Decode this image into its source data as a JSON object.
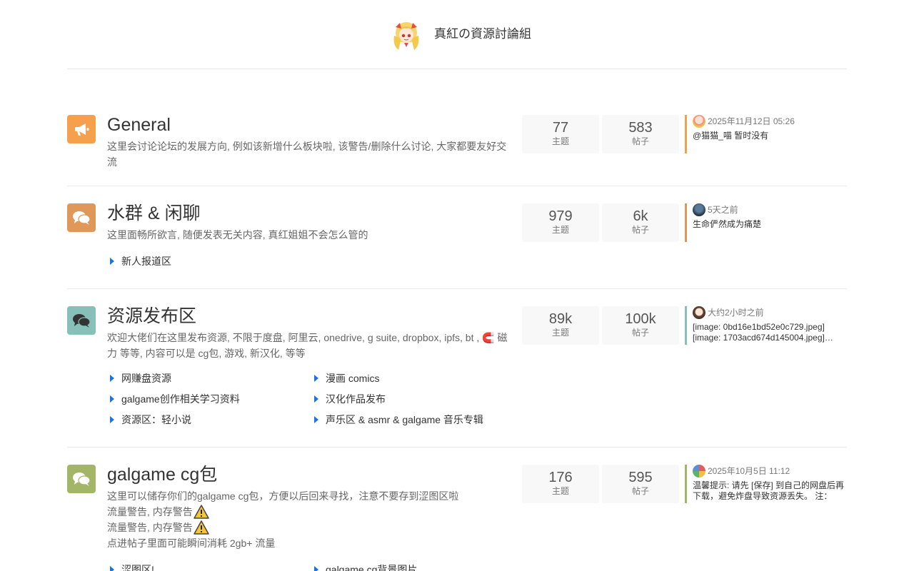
{
  "site": {
    "title": "真紅の資源討論組"
  },
  "categories": [
    {
      "name": "General",
      "icon": "megaphone-icon",
      "color": "#f5a04d",
      "desc": [
        "这里会讨论论坛的发展方向, 例如该新增什么板块啦, 该警告/删除什么讨论, 大家都要友好交流"
      ],
      "topics": "77",
      "posts": "583",
      "topics_label": "主题",
      "posts_label": "帖子",
      "latest_time": "2025年11月12日 05:26",
      "latest_text": "@猫猫_喵 暂时没有",
      "latest_color": "#f5a04d",
      "subcats": []
    },
    {
      "name": "水群 & 闲聊",
      "icon": "chat-bubbles-icon",
      "color": "#e0975a",
      "desc": [
        "这里面畅所欲言, 随便发表无关内容, 真红姐姐不会怎么管的"
      ],
      "topics": "979",
      "posts": "6k",
      "topics_label": "主题",
      "posts_label": "帖子",
      "latest_time": "5天之前",
      "latest_text": "生命俨然成为痛楚",
      "latest_color": "#e0975a",
      "subcats": [
        "新人报道区"
      ]
    },
    {
      "name": "资源发布区",
      "icon": "chat-bubbles-icon",
      "color": "#86c0b8",
      "desc": [
        "欢迎大佬们在这里发布资源, 不限于度盘, 阿里云, onedrive, g suite, dropbox, ipfs, bt , 🧲 磁力 等等, 内容可以是 cg包, 游戏, 新汉化, 等等"
      ],
      "topics": "89k",
      "posts": "100k",
      "topics_label": "主题",
      "posts_label": "帖子",
      "latest_time": "大约2小时之前",
      "latest_text": "[image: 0bd16e1bd52e0c729.jpeg] [image: 1703acd674d145004.jpeg]…",
      "latest_color": "#86c0b8",
      "subcats": [
        "网赚盘资源",
        "漫画 comics",
        "galgame创作相关学习资料",
        "汉化作品发布",
        "资源区：轻小说",
        "声乐区 & asmr & galgame 音乐专辑"
      ]
    },
    {
      "name": "galgame cg包",
      "icon": "chat-bubbles-icon",
      "color": "#a3b567",
      "desc": [
        "这里可以储存你们的galgame cg包，方便以后回来寻找，注意不要存到涩图区啦",
        "流量警告, 内存警告",
        "流量警告, 内存警告",
        "点进帖子里面可能瞬间消耗 2gb+ 流量"
      ],
      "topics": "176",
      "posts": "595",
      "topics_label": "主题",
      "posts_label": "帖子",
      "latest_time": "2025年10月5日 11:12",
      "latest_text": "温馨提示: 请先 [保存] 到自己的网盘后再下载，避免炸盘导致资源丢失。 注：解…",
      "latest_color": "#a3b567",
      "subcats": [
        "涩图区!",
        "galgame cg背景图片"
      ]
    }
  ]
}
